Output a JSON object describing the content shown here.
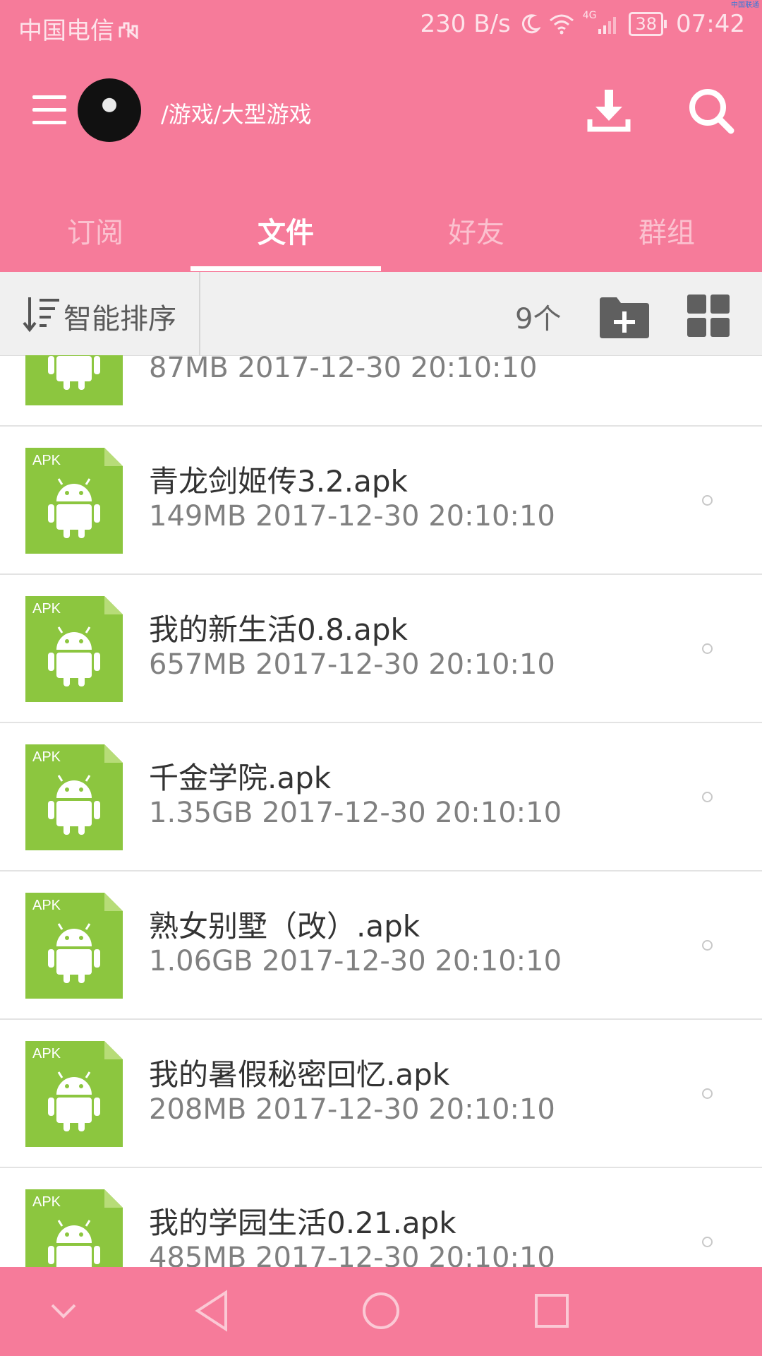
{
  "status_bar": {
    "carrier": "中国电信",
    "net_speed": "230 B/s",
    "network_type": "4G",
    "battery": "38",
    "time": "07:42",
    "corner_label": "中国联通"
  },
  "header": {
    "path": "/游戏/大型游戏"
  },
  "tabs": [
    {
      "label": "订阅",
      "active": false
    },
    {
      "label": "文件",
      "active": true
    },
    {
      "label": "好友",
      "active": false
    },
    {
      "label": "群组",
      "active": false
    }
  ],
  "toolbar": {
    "sort_label": "智能排序",
    "count": "9个"
  },
  "apk_badge": "APK",
  "files": [
    {
      "name": "",
      "meta": "87MB 2017-12-30 20:10:10"
    },
    {
      "name": "青龙剑姬传3.2.apk",
      "meta": "149MB 2017-12-30 20:10:10"
    },
    {
      "name": "我的新生活0.8.apk",
      "meta": "657MB 2017-12-30 20:10:10"
    },
    {
      "name": "千金学院.apk",
      "meta": "1.35GB 2017-12-30 20:10:10"
    },
    {
      "name": "熟女别墅（改）.apk",
      "meta": "1.06GB 2017-12-30 20:10:10"
    },
    {
      "name": "我的暑假秘密回忆.apk",
      "meta": "208MB 2017-12-30 20:10:10"
    },
    {
      "name": "我的学园生活0.21.apk",
      "meta": "485MB 2017-12-30 20:10:10"
    }
  ],
  "colors": {
    "accent": "#f67b9a",
    "apk_green": "#8cc63f"
  }
}
